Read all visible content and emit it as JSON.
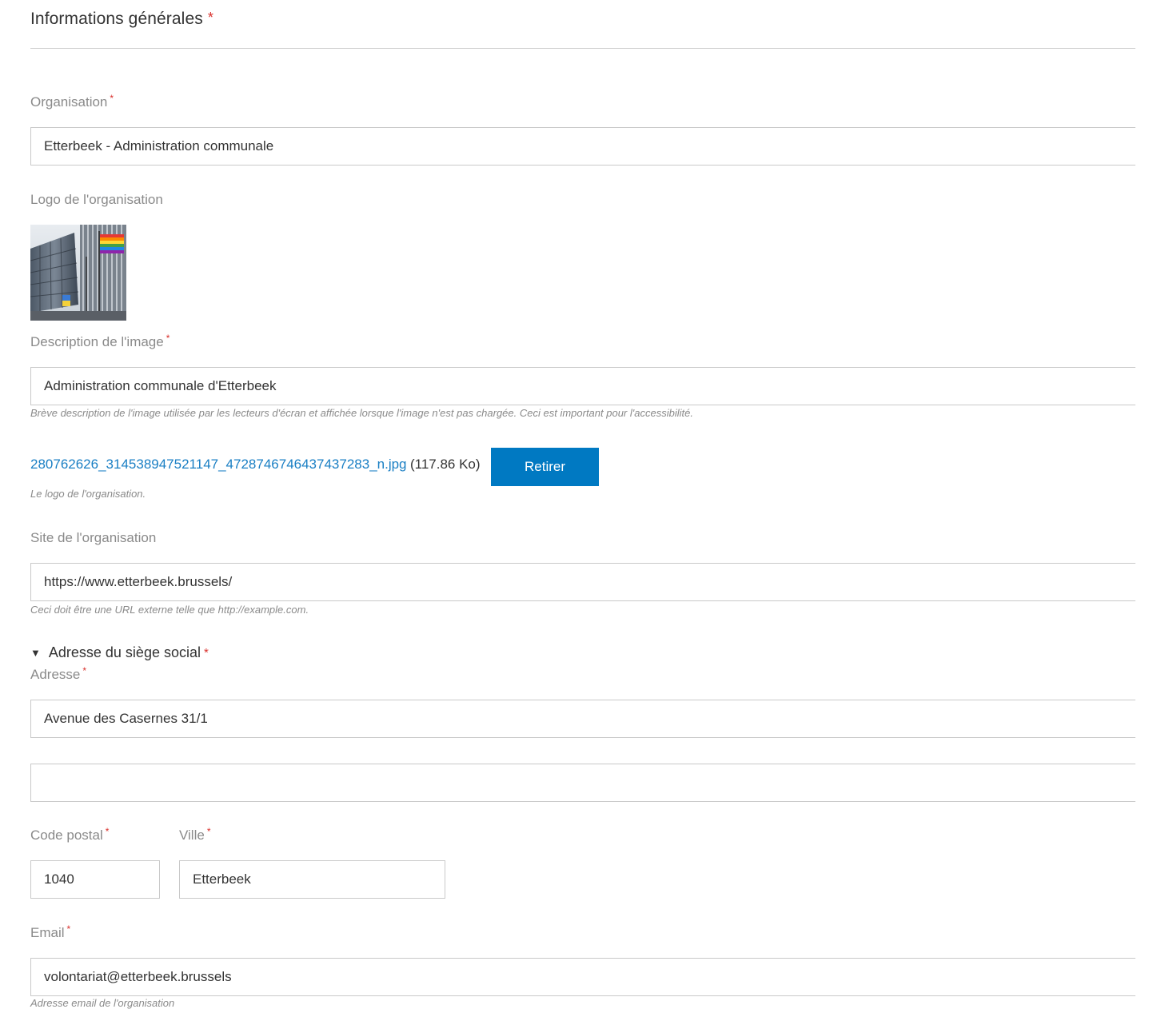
{
  "section": {
    "title": "Informations générales",
    "required_mark": "*"
  },
  "organisation": {
    "label": "Organisation",
    "required_mark": "*",
    "value": "Etterbeek - Administration communale"
  },
  "logo": {
    "label": "Logo de l'organisation"
  },
  "image_description": {
    "label": "Description de l'image",
    "required_mark": "*",
    "value": "Administration communale d'Etterbeek",
    "help": "Brève description de l'image utilisée par les lecteurs d'écran et affichée lorsque l'image n'est pas chargée. Ceci est important pour l'accessibilité."
  },
  "file": {
    "name": "280762626_314538947521147_4728746746437437283_n.jpg",
    "size": "(117.86 Ko)",
    "remove_label": "Retirer",
    "help": "Le logo de l'organisation."
  },
  "website": {
    "label": "Site de l'organisation",
    "value": "https://www.etterbeek.brussels/",
    "help": "Ceci doit être une URL externe telle que http://example.com."
  },
  "address": {
    "summary": "Adresse du siège social",
    "required_mark": "*",
    "label": "Adresse",
    "line1": "Avenue des Casernes 31/1",
    "line2": "",
    "postal_label": "Code postal",
    "postal_value": "1040",
    "city_label": "Ville",
    "city_value": "Etterbeek"
  },
  "email": {
    "label": "Email",
    "required_mark": "*",
    "value": "volontariat@etterbeek.brussels",
    "help": "Adresse email de l'organisation"
  },
  "colors": {
    "accent": "#0079c2",
    "link": "#1a7fc4",
    "required": "#d9302c"
  }
}
